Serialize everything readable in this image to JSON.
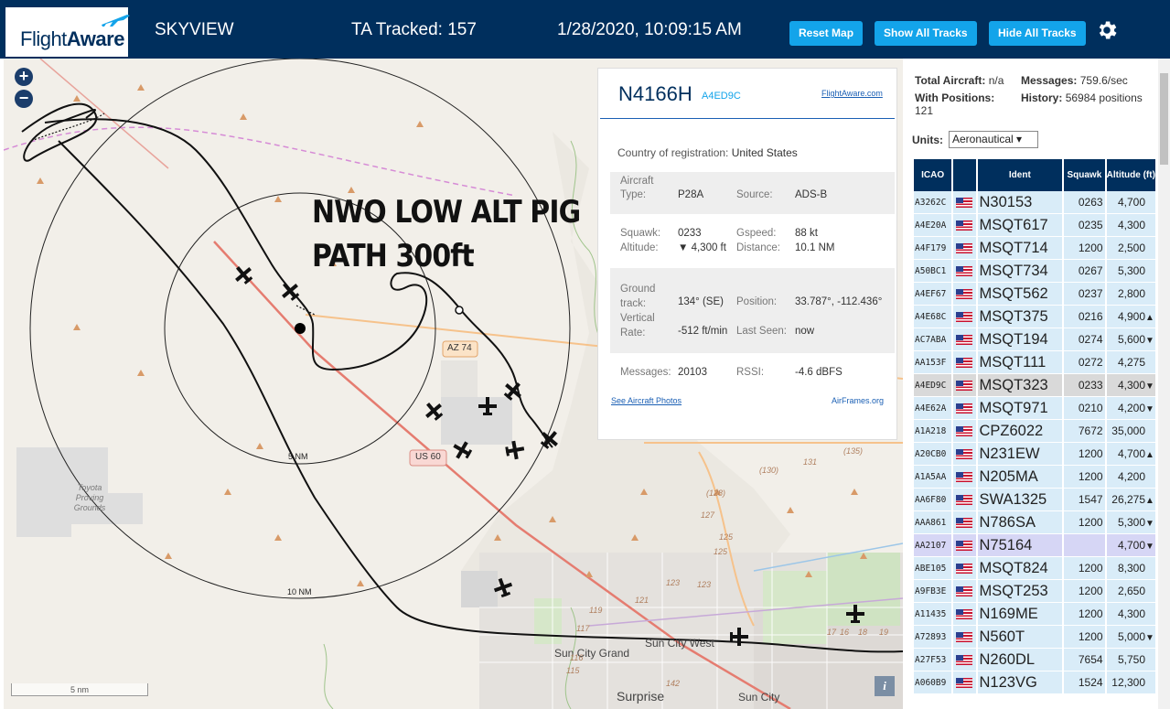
{
  "header": {
    "logo_text_a": "Flight",
    "logo_text_b": "Aware",
    "app_name": "SKYVIEW",
    "tracked": "TA Tracked: 157",
    "datetime": "1/28/2020, 10:09:15 AM",
    "reset_label": "Reset Map",
    "show_label": "Show All Tracks",
    "hide_label": "Hide All Tracks",
    "settings_icon": "gear-icon"
  },
  "map": {
    "zoom_in": "+",
    "zoom_out": "−",
    "overlay_line1": "NWO LOW ALT PIG",
    "overlay_line2": "PATH 300ft",
    "range_5": "5 NM",
    "range_10": "10 NM",
    "road_az74": "AZ 74",
    "road_us60": "US 60",
    "label_toyota": "Toyota Proving Grounds",
    "label_suncitygrand": "Sun City Grand",
    "label_suncitywest": "Sun City West",
    "label_surprise": "Surprise",
    "label_suncity": "Sun City",
    "scale": "5 nm",
    "info": "i",
    "route_numbers": [
      "(135)",
      "131",
      "(130)",
      "(128)",
      "127",
      "125",
      "123",
      "119",
      "117",
      "116",
      "115",
      "142",
      "17",
      "16",
      "18",
      "19",
      "125",
      "123",
      "121"
    ]
  },
  "detail": {
    "registration": "N4166H",
    "hex": "A4ED9C",
    "fa_link": "FlightAware.com",
    "country_label": "Country of registration:",
    "country": "United States",
    "aircraft_type_label": "Aircraft Type:",
    "aircraft_type": "P28A",
    "source_label": "Source:",
    "source": "ADS-B",
    "squawk_label": "Squawk:",
    "squawk": "0233",
    "gspeed_label": "Gspeed:",
    "gspeed": "88 kt",
    "altitude_label": "Altitude:",
    "altitude": "▼ 4,300 ft",
    "distance_label": "Distance:",
    "distance": "10.1 NM",
    "track_label": "Ground track:",
    "track": "134° (SE)",
    "position_label": "Position:",
    "position": "33.787°, -112.436°",
    "vrate_label": "Vertical Rate:",
    "vrate": "-512 ft/min",
    "lastseen_label": "Last Seen:",
    "lastseen": "now",
    "messages_label": "Messages:",
    "messages": "20103",
    "rssi_label": "RSSI:",
    "rssi": "-4.6 dBFS",
    "photos_link": "See Aircraft Photos",
    "airframes_link": "AirFrames.org"
  },
  "panel": {
    "total_label": "Total Aircraft:",
    "total": "n/a",
    "messages_label": "Messages:",
    "messages": "759.6/sec",
    "withpos_label": "With Positions:",
    "withpos": "121",
    "history_label": "History:",
    "history": "56984 positions",
    "units_label": "Units:",
    "units_value": "Aeronautical ▾",
    "columns": [
      "ICAO",
      "",
      "Ident",
      "Squawk",
      "Altitude (ft)"
    ],
    "rows": [
      {
        "icao": "A3262C",
        "ident": "N30153",
        "squawk": "0263",
        "alt": "4,700",
        "trend": ""
      },
      {
        "icao": "A4E20A",
        "ident": "MSQT617",
        "squawk": "0235",
        "alt": "4,300",
        "trend": ""
      },
      {
        "icao": "A4F179",
        "ident": "MSQT714",
        "squawk": "1200",
        "alt": "2,500",
        "trend": ""
      },
      {
        "icao": "A50BC1",
        "ident": "MSQT734",
        "squawk": "0267",
        "alt": "5,300",
        "trend": ""
      },
      {
        "icao": "A4EF67",
        "ident": "MSQT562",
        "squawk": "0237",
        "alt": "2,800",
        "trend": ""
      },
      {
        "icao": "A4E68C",
        "ident": "MSQT375",
        "squawk": "0216",
        "alt": "4,900",
        "trend": "▲"
      },
      {
        "icao": "AC7ABA",
        "ident": "MSQT194",
        "squawk": "0274",
        "alt": "5,600",
        "trend": "▼"
      },
      {
        "icao": "AA153F",
        "ident": "MSQT111",
        "squawk": "0272",
        "alt": "4,275",
        "trend": ""
      },
      {
        "icao": "A4ED9C",
        "ident": "MSQT323",
        "squawk": "0233",
        "alt": "4,300",
        "trend": "▼"
      },
      {
        "icao": "A4E62A",
        "ident": "MSQT971",
        "squawk": "0210",
        "alt": "4,200",
        "trend": "▼"
      },
      {
        "icao": "A1A218",
        "ident": "CPZ6022",
        "squawk": "7672",
        "alt": "35,000",
        "trend": ""
      },
      {
        "icao": "A20CB0",
        "ident": "N231EW",
        "squawk": "1200",
        "alt": "4,700",
        "trend": "▲"
      },
      {
        "icao": "A1A5AA",
        "ident": "N205MA",
        "squawk": "1200",
        "alt": "4,200",
        "trend": ""
      },
      {
        "icao": "AA6F80",
        "ident": "SWA1325",
        "squawk": "1547",
        "alt": "26,275",
        "trend": "▲"
      },
      {
        "icao": "AAA861",
        "ident": "N786SA",
        "squawk": "1200",
        "alt": "5,300",
        "trend": "▼"
      },
      {
        "icao": "AA2107",
        "ident": "N75164",
        "squawk": "",
        "alt": "4,700",
        "trend": "▼"
      },
      {
        "icao": "ABE105",
        "ident": "MSQT824",
        "squawk": "1200",
        "alt": "8,300",
        "trend": ""
      },
      {
        "icao": "A9FB3E",
        "ident": "MSQT253",
        "squawk": "1200",
        "alt": "2,650",
        "trend": ""
      },
      {
        "icao": "A11435",
        "ident": "N169ME",
        "squawk": "1200",
        "alt": "4,300",
        "trend": ""
      },
      {
        "icao": "A72893",
        "ident": "N560T",
        "squawk": "1200",
        "alt": "5,000",
        "trend": "▼"
      },
      {
        "icao": "A27F53",
        "ident": "N260DL",
        "squawk": "7654",
        "alt": "5,750",
        "trend": ""
      },
      {
        "icao": "A060B9",
        "ident": "N123VG",
        "squawk": "1524",
        "alt": "12,300",
        "trend": ""
      }
    ]
  },
  "colors": {
    "header_bg": "#002f5d",
    "button_bg": "#13a4ea",
    "row_bg": "#d9ecf8",
    "selected_row_bg": "#d9d9d9",
    "highlight_row_bg": "#d6d6f5"
  }
}
